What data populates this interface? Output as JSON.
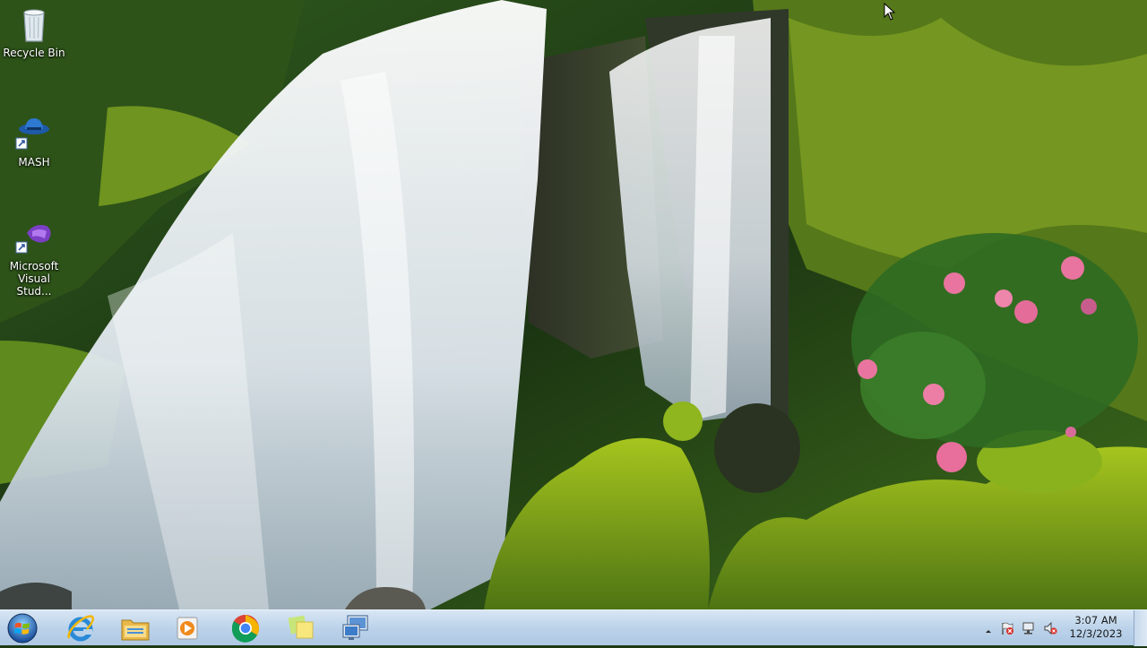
{
  "desktop": {
    "icons": [
      {
        "label": "Recycle Bin",
        "icon": "recycle-bin-icon"
      },
      {
        "label": "MASH",
        "icon": "mash-app-icon"
      },
      {
        "label": "Microsoft Visual Stud...",
        "label_line1": "Microsoft",
        "label_line2": "Visual Stud...",
        "icon": "visual-studio-icon"
      }
    ]
  },
  "taskbar": {
    "start_icon": "windows-start-orb-icon",
    "pinned": [
      {
        "name": "internet-explorer",
        "icon": "internet-explorer-icon"
      },
      {
        "name": "file-explorer",
        "icon": "folder-icon"
      },
      {
        "name": "media-player",
        "icon": "media-player-icon"
      },
      {
        "name": "google-chrome",
        "icon": "chrome-icon"
      },
      {
        "name": "sticky-notes",
        "icon": "sticky-notes-icon"
      },
      {
        "name": "remote-desktop",
        "icon": "remote-desktop-icon"
      }
    ],
    "tray": {
      "icons": [
        "show-hidden-icons-chevron-icon",
        "action-center-flag-icon",
        "network-icon",
        "volume-muted-icon"
      ],
      "clock_time": "3:07 AM",
      "clock_date": "12/3/2023"
    }
  },
  "colors": {
    "taskbar_top": "#d8e6f4",
    "taskbar_bottom": "#aec8e3",
    "accent_red": "#d9302a"
  }
}
